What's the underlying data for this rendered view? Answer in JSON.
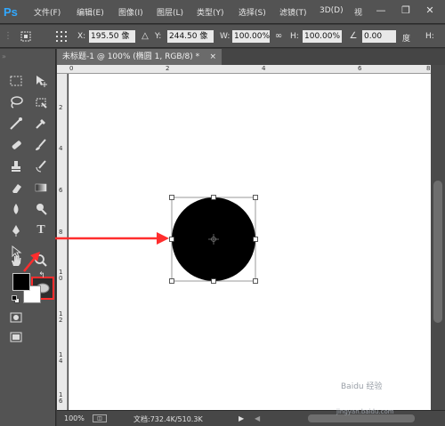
{
  "app": {
    "logo": "Ps"
  },
  "menu": {
    "items": [
      {
        "label": "文件(F)"
      },
      {
        "label": "编辑(E)"
      },
      {
        "label": "图像(I)"
      },
      {
        "label": "图层(L)"
      },
      {
        "label": "类型(Y)"
      },
      {
        "label": "选择(S)"
      },
      {
        "label": "滤镜(T)"
      },
      {
        "label": "3D(D)"
      },
      {
        "label": "视"
      }
    ],
    "window_controls": {
      "minimize": "—",
      "restore": "❐",
      "close": "✕"
    }
  },
  "options_bar": {
    "x_label": "X:",
    "x_value": "195.50 像",
    "y_label": "Y:",
    "y_value": "244.50 像",
    "w_label": "W:",
    "w_value": "100.00%",
    "h_label": "H:",
    "h_value": "100.00%",
    "angle_value": "0.00",
    "angle_unit": "度",
    "last_icon": "H:"
  },
  "document": {
    "tab_title": "未标题-1 @ 100% (椭圆 1, RGB/8) *",
    "tab_close": "×"
  },
  "ruler_top": {
    "labels": [
      "0",
      "2",
      "4",
      "6",
      "8"
    ]
  },
  "ruler_left": {
    "labels": [
      "2",
      "4",
      "6",
      "8",
      "1 0",
      "1 2",
      "1 4",
      "1 6"
    ]
  },
  "status": {
    "zoom": "100%",
    "doc_info": "文档:732.4K/510.3K"
  },
  "watermark": {
    "text": "Baidu 经验",
    "sub": "jingyan.baidu.com"
  },
  "colors": {
    "accent_red": "#ff2d2d",
    "foreground": "#000000",
    "background": "#ffffff",
    "ps_blue": "#31a8ff"
  }
}
